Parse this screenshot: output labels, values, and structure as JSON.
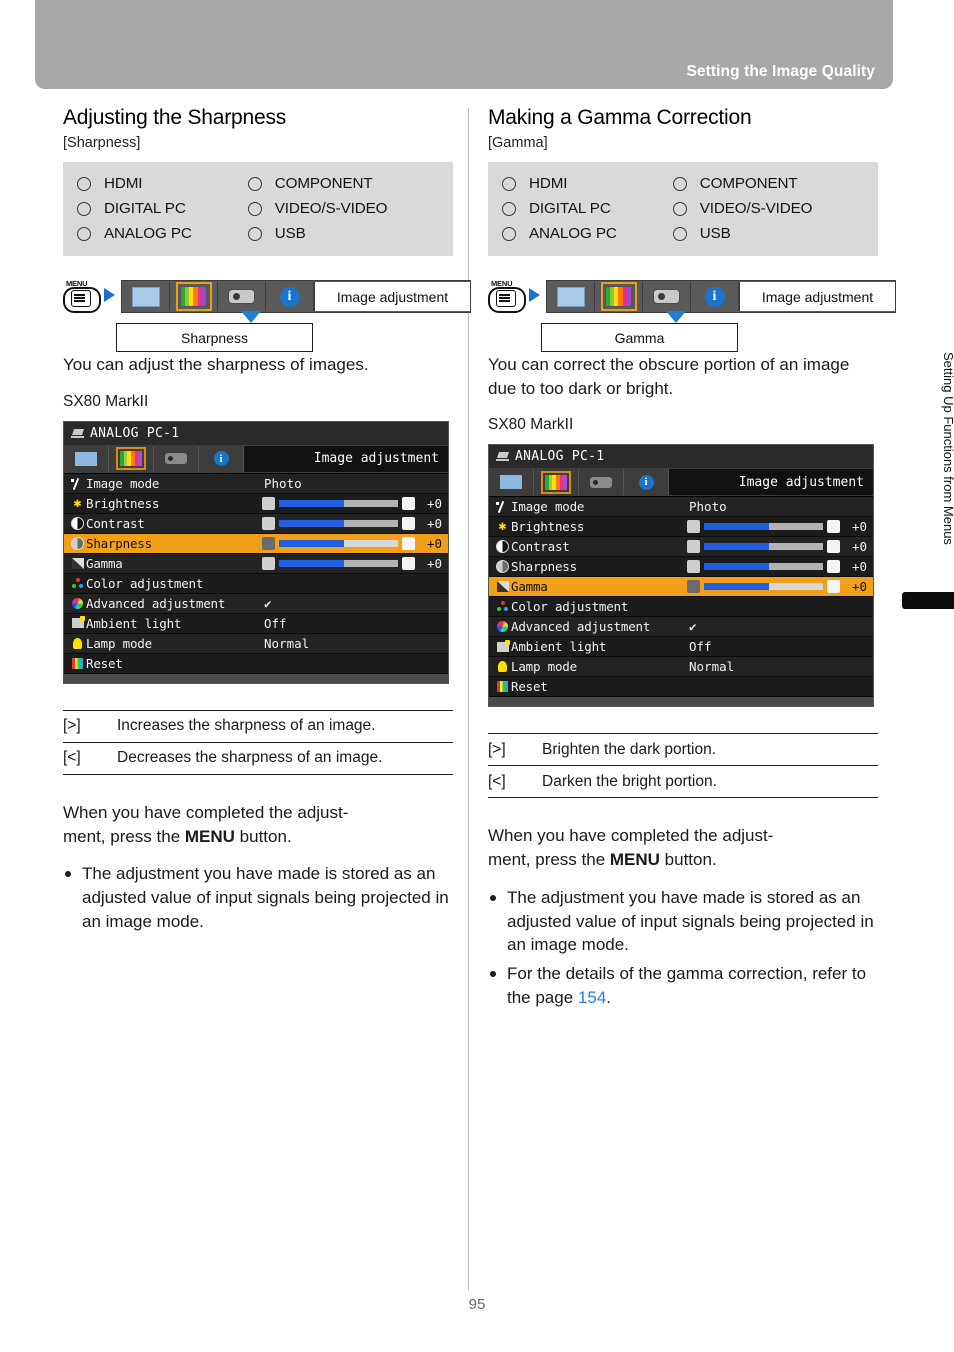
{
  "header": {
    "title": "Setting the Image Quality"
  },
  "footer": {
    "page_number": "95"
  },
  "side_tab": {
    "label": "Setting Up Functions from Menus"
  },
  "columns": [
    {
      "title": "Adjusting the Sharpness",
      "bracket_label": "[Sharpness]",
      "sources_left": [
        "HDMI",
        "DIGITAL PC",
        "ANALOG PC"
      ],
      "sources_right": [
        "COMPONENT",
        "VIDEO/S-VIDEO",
        "USB"
      ],
      "menu_path": {
        "menu_button_label": "MENU",
        "tab_title": "Image adjustment",
        "leaf": "Sharpness"
      },
      "description": "You can adjust the sharpness of images.",
      "model": "SX80 MarkII",
      "osd": {
        "source": "ANALOG PC-1",
        "tab_title": "Image adjustment",
        "highlight": "Sharpness",
        "rows": [
          {
            "icon": "image-mode-icon",
            "label": "Image mode",
            "value": "Photo",
            "type": "value"
          },
          {
            "icon": "brightness-icon",
            "label": "Brightness",
            "value": "+0",
            "type": "slider",
            "fill": 55
          },
          {
            "icon": "contrast-icon",
            "label": "Contrast",
            "value": "+0",
            "type": "slider",
            "fill": 55
          },
          {
            "icon": "sharpness-icon",
            "label": "Sharpness",
            "value": "+0",
            "type": "slider",
            "fill": 55
          },
          {
            "icon": "gamma-icon",
            "label": "Gamma",
            "value": "+0",
            "type": "slider",
            "fill": 55
          },
          {
            "icon": "color-adjustment-icon",
            "label": "Color adjustment",
            "value": "",
            "type": "value"
          },
          {
            "icon": "advanced-adjustment-icon",
            "label": "Advanced adjustment",
            "value": "✔",
            "type": "value"
          },
          {
            "icon": "ambient-light-icon",
            "label": "Ambient light",
            "value": "Off",
            "type": "value"
          },
          {
            "icon": "lamp-mode-icon",
            "label": "Lamp mode",
            "value": "Normal",
            "type": "value"
          },
          {
            "icon": "reset-icon",
            "label": "Reset",
            "value": "",
            "type": "value"
          }
        ]
      },
      "keys": [
        {
          "key": "[>]",
          "desc": "Increases the sharpness of an image."
        },
        {
          "key": "[<]",
          "desc": "Decreases the sharpness of an image."
        }
      ],
      "after_text_1": "When you have completed the adjust-",
      "after_text_2": "ment, press the ",
      "after_bold": "MENU",
      "after_text_3": " button.",
      "bullets": [
        {
          "text": "The adjustment you have made is stored as an adjusted value of input signals being projected in an image mode.",
          "ref": ""
        }
      ]
    },
    {
      "title": "Making a Gamma Correction",
      "bracket_label": "[Gamma]",
      "sources_left": [
        "HDMI",
        "DIGITAL PC",
        "ANALOG PC"
      ],
      "sources_right": [
        "COMPONENT",
        "VIDEO/S-VIDEO",
        "USB"
      ],
      "menu_path": {
        "menu_button_label": "MENU",
        "tab_title": "Image adjustment",
        "leaf": "Gamma"
      },
      "description": "You can correct the obscure portion of an image due to too dark or bright.",
      "model": "SX80 MarkII",
      "osd": {
        "source": "ANALOG PC-1",
        "tab_title": "Image adjustment",
        "highlight": "Gamma",
        "rows": [
          {
            "icon": "image-mode-icon",
            "label": "Image mode",
            "value": "Photo",
            "type": "value"
          },
          {
            "icon": "brightness-icon",
            "label": "Brightness",
            "value": "+0",
            "type": "slider",
            "fill": 55
          },
          {
            "icon": "contrast-icon",
            "label": "Contrast",
            "value": "+0",
            "type": "slider",
            "fill": 55
          },
          {
            "icon": "sharpness-icon",
            "label": "Sharpness",
            "value": "+0",
            "type": "slider",
            "fill": 55
          },
          {
            "icon": "gamma-icon",
            "label": "Gamma",
            "value": "+0",
            "type": "slider",
            "fill": 55
          },
          {
            "icon": "color-adjustment-icon",
            "label": "Color adjustment",
            "value": "",
            "type": "value"
          },
          {
            "icon": "advanced-adjustment-icon",
            "label": "Advanced adjustment",
            "value": "✔",
            "type": "value"
          },
          {
            "icon": "ambient-light-icon",
            "label": "Ambient light",
            "value": "Off",
            "type": "value"
          },
          {
            "icon": "lamp-mode-icon",
            "label": "Lamp mode",
            "value": "Normal",
            "type": "value"
          },
          {
            "icon": "reset-icon",
            "label": "Reset",
            "value": "",
            "type": "value"
          }
        ]
      },
      "keys": [
        {
          "key": "[>]",
          "desc": "Brighten the dark portion."
        },
        {
          "key": "[<]",
          "desc": "Darken the bright portion."
        }
      ],
      "after_text_1": "When you have completed the adjust-",
      "after_text_2": "ment, press the ",
      "after_bold": "MENU",
      "after_text_3": " button.",
      "bullets": [
        {
          "text": "The adjustment you have made is stored as an adjusted value of input signals being projected in an image mode.",
          "ref": ""
        },
        {
          "text": "For the details of the gamma correction, refer to the page ",
          "ref": "154",
          "suffix": "."
        }
      ]
    }
  ],
  "colors": {
    "header_band": "#a8a8a8",
    "source_box": "#d9d9d9",
    "osd_highlight": "#f2a01a",
    "slider_fill": "#1f5fe0",
    "link": "#2b7fd4"
  }
}
